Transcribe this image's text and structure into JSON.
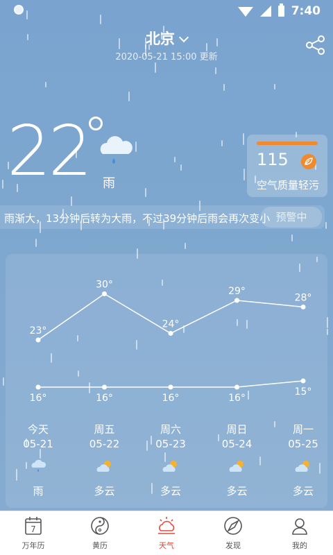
{
  "status_bar": {
    "time": "7:40"
  },
  "header": {
    "city": "北京",
    "updated": "2020-05-21 15:00 更新"
  },
  "current": {
    "temp": "22",
    "condition": "雨"
  },
  "aqi": {
    "value": "115",
    "label": "空气质量轻污",
    "color": "#f08a2e"
  },
  "alert": {
    "text": "雨渐大，13分钟后转为大雨，不过39分钟后雨会再次变小",
    "tag": "预警中"
  },
  "forecast": {
    "days": [
      {
        "name": "今天",
        "date": "05-21",
        "cond": "雨",
        "icon": "rain-cloud-icon",
        "high": "23°",
        "low": "16°"
      },
      {
        "name": "周五",
        "date": "05-22",
        "cond": "多云",
        "icon": "partly-cloudy-icon",
        "high": "30°",
        "low": "16°"
      },
      {
        "name": "周六",
        "date": "05-23",
        "cond": "多云",
        "icon": "partly-cloudy-icon",
        "high": "24°",
        "low": "16°"
      },
      {
        "name": "周日",
        "date": "05-24",
        "cond": "多云",
        "icon": "partly-cloudy-icon",
        "high": "29°",
        "low": "16°"
      },
      {
        "name": "周一",
        "date": "05-25",
        "cond": "多云",
        "icon": "partly-cloudy-icon",
        "high": "28°",
        "low": "15°"
      }
    ],
    "highs": [
      23,
      30,
      24,
      29,
      28
    ],
    "lows": [
      16,
      16,
      16,
      16,
      15
    ]
  },
  "nav": {
    "items": [
      {
        "label": "万年历",
        "icon": "calendar-icon"
      },
      {
        "label": "黄历",
        "icon": "yinyang-icon"
      },
      {
        "label": "天气",
        "icon": "weather-sun-icon"
      },
      {
        "label": "发现",
        "icon": "compass-icon"
      },
      {
        "label": "我的",
        "icon": "user-icon"
      }
    ],
    "active": "天气",
    "active_color": "#e24a3b",
    "calendar_day": "7"
  }
}
